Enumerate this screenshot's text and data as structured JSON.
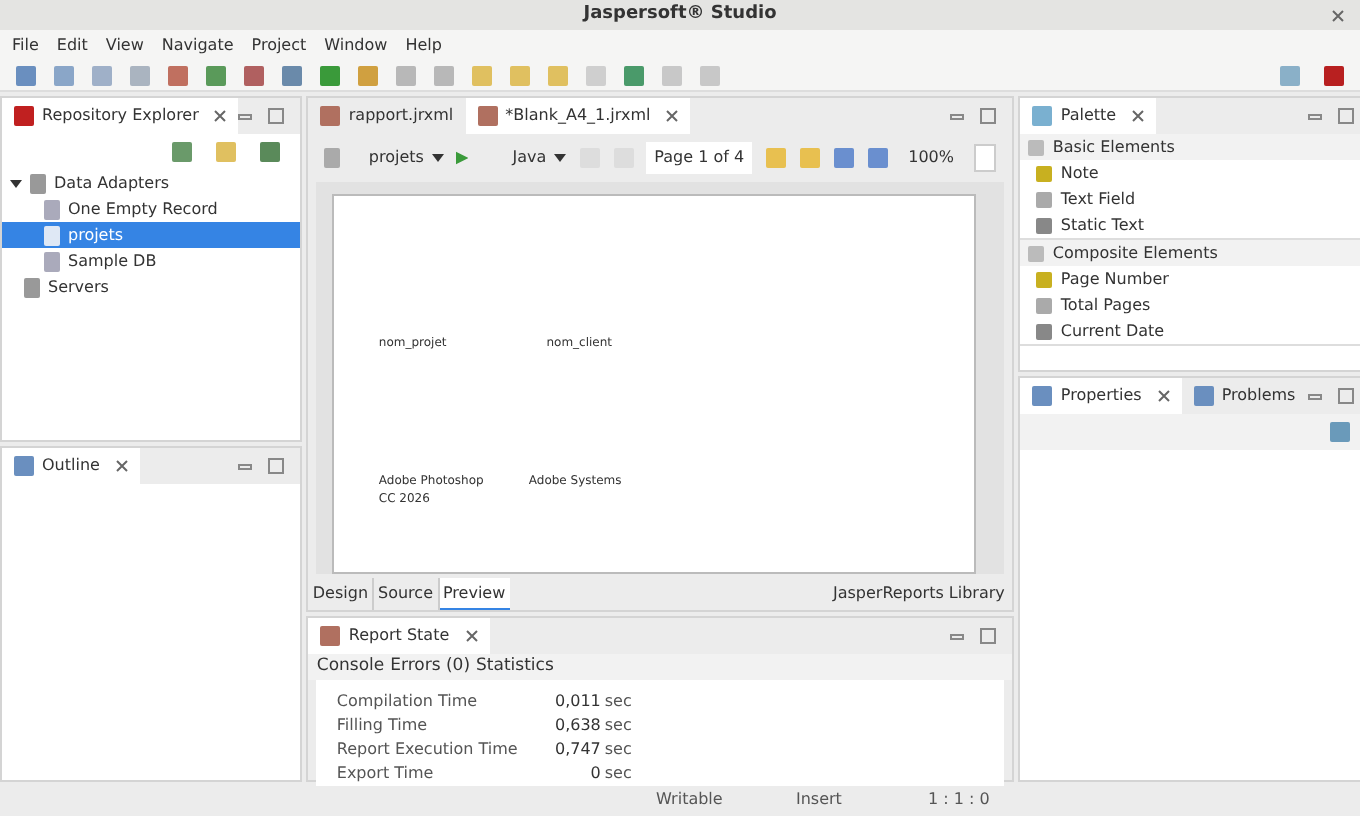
{
  "window": {
    "title": "Jaspersoft® Studio"
  },
  "menu": [
    "File",
    "Edit",
    "View",
    "Navigate",
    "Project",
    "Window",
    "Help"
  ],
  "repository_explorer": {
    "title": "Repository Explorer",
    "tree": [
      {
        "label": "Data Adapters",
        "expanded": true,
        "selected": false,
        "children": [
          {
            "label": "One Empty Record",
            "selected": false
          },
          {
            "label": "projets",
            "selected": true
          },
          {
            "label": "Sample DB",
            "selected": false
          }
        ]
      },
      {
        "label": "Servers",
        "selected": false
      }
    ]
  },
  "outline": {
    "title": "Outline"
  },
  "editor": {
    "tabs": [
      {
        "label": "rapport.jrxml",
        "selected": false
      },
      {
        "label": "*Blank_A4_1.jrxml",
        "selected": true
      }
    ],
    "toolbar": {
      "adapter": "projets",
      "language": "Java",
      "page": "Page 1 of 4",
      "zoom": "100%"
    },
    "page": {
      "headers": [
        "nom_projet",
        "nom_client"
      ],
      "values": [
        "Adobe Photoshop\nCC 2026",
        "Adobe Systems"
      ]
    },
    "bottom_tabs": [
      {
        "label": "Design",
        "selected": false
      },
      {
        "label": "Source",
        "selected": false
      },
      {
        "label": "Preview",
        "selected": true
      }
    ],
    "library": "JasperReports Library"
  },
  "report_state": {
    "title": "Report State",
    "tabs": [
      "Console",
      "Errors (0)",
      "Statistics"
    ],
    "stats": [
      {
        "label": "Compilation Time",
        "value": "0,011",
        "unit": "sec"
      },
      {
        "label": "Filling Time",
        "value": "0,638",
        "unit": "sec"
      },
      {
        "label": "Report Execution Time",
        "value": "0,747",
        "unit": "sec"
      },
      {
        "label": "Export Time",
        "value": "0",
        "unit": "sec"
      }
    ]
  },
  "palette": {
    "title": "Palette",
    "sections": [
      {
        "title": "Basic Elements",
        "items": [
          "Note",
          "Text Field",
          "Static Text"
        ]
      },
      {
        "title": "Composite Elements",
        "items": [
          "Page Number",
          "Total Pages",
          "Current Date"
        ]
      }
    ]
  },
  "properties": {
    "tabs": [
      {
        "label": "Properties",
        "selected": true
      },
      {
        "label": "Problems",
        "selected": false
      }
    ]
  },
  "status_bar": [
    "Writable",
    "Insert",
    "1 : 1 : 0"
  ]
}
